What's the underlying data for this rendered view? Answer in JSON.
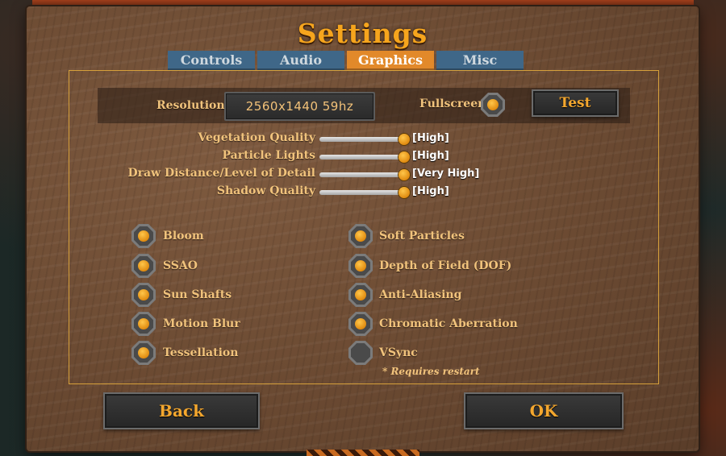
{
  "title": "Settings",
  "tabs": [
    {
      "label": "Controls",
      "active": false
    },
    {
      "label": "Audio",
      "active": false
    },
    {
      "label": "Graphics",
      "active": true
    },
    {
      "label": "Misc",
      "active": false
    }
  ],
  "resolution": {
    "label": "Resolution",
    "value": "2560x1440  59hz",
    "fullscreen_label": "Fullscreen",
    "fullscreen_checked": true,
    "test_label": "Test"
  },
  "sliders": [
    {
      "label": "Vegetation Quality",
      "value": "[High]"
    },
    {
      "label": "Particle Lights",
      "value": "[High]"
    },
    {
      "label": "Draw Distance/Level of Detail",
      "value": "[Very High]"
    },
    {
      "label": "Shadow Quality",
      "value": "[High]"
    }
  ],
  "options_left": [
    {
      "label": "Bloom",
      "checked": true
    },
    {
      "label": "SSAO",
      "checked": true
    },
    {
      "label": "Sun Shafts",
      "checked": true
    },
    {
      "label": "Motion Blur",
      "checked": true
    },
    {
      "label": "Tessellation",
      "checked": true
    }
  ],
  "options_right": [
    {
      "label": "Soft Particles",
      "checked": true
    },
    {
      "label": "Depth of Field (DOF)",
      "checked": true
    },
    {
      "label": "Anti-Aliasing",
      "checked": true
    },
    {
      "label": "Chromatic Aberration",
      "checked": true
    },
    {
      "label": "VSync",
      "checked": false
    }
  ],
  "restart_note": "* Requires restart",
  "buttons": {
    "back": "Back",
    "ok": "OK"
  },
  "colors": {
    "accent": "#f6a51d",
    "tab_active": "#e2892a",
    "tab_inactive": "#3f6788",
    "checkbox_on": "#f0a020"
  }
}
